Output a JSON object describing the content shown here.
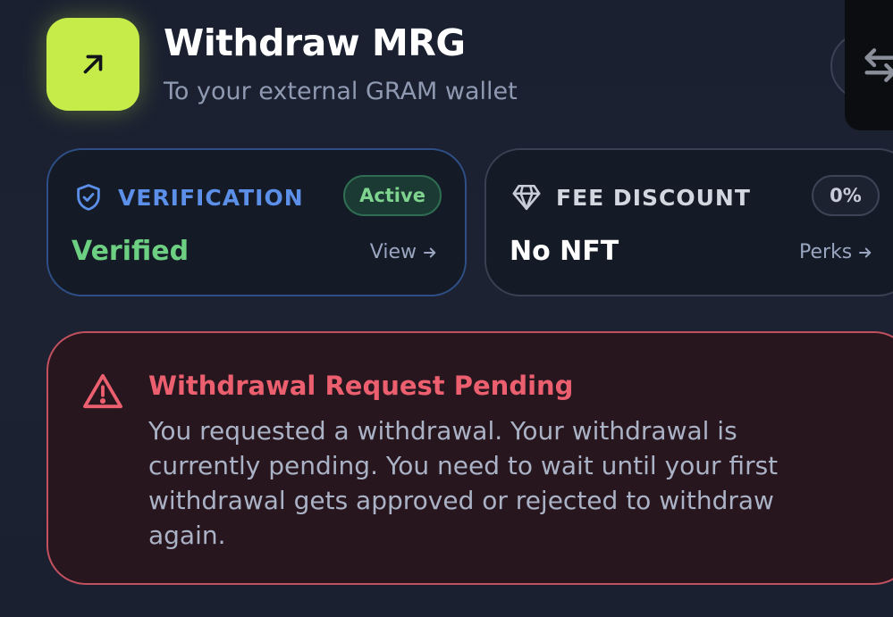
{
  "header": {
    "title": "Withdraw MRG",
    "subtitle": "To your external GRAM wallet",
    "icon": "arrow-up-right-icon",
    "accent_color": "#c6ec4a"
  },
  "controls": {
    "close_icon": "close-icon",
    "side_icon": "swap-arrows-icon"
  },
  "verification_card": {
    "label": "VERIFICATION",
    "badge": "Active",
    "value": "Verified",
    "link": "View",
    "icon": "shield-check-icon"
  },
  "fee_card": {
    "label": "FEE DISCOUNT",
    "badge": "0%",
    "value": "No NFT",
    "link": "Perks",
    "icon": "diamond-icon"
  },
  "alert": {
    "title": "Withdrawal Request Pending",
    "message": "You requested a withdrawal. Your withdrawal is currently pending. You need to wait until your first withdrawal gets approved or rejected to withdraw again.",
    "icon": "warning-triangle-icon",
    "color": "#ec5f6f"
  }
}
